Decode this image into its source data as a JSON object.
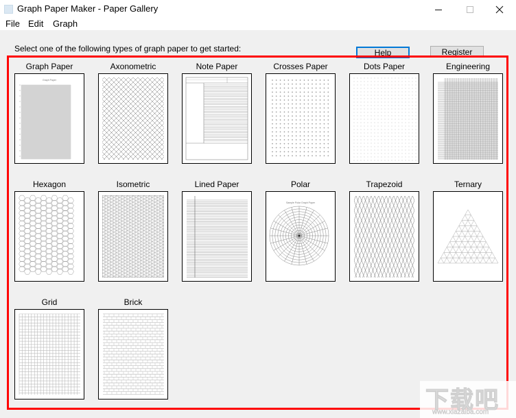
{
  "window": {
    "title": "Graph Paper Maker - Paper Gallery",
    "controls": {
      "minimize": "minimize",
      "maximize": "maximize",
      "close": "close"
    }
  },
  "menu": {
    "items": [
      {
        "label": "File"
      },
      {
        "label": "Edit"
      },
      {
        "label": "Graph"
      }
    ]
  },
  "main": {
    "instruction": "Select one of the following types of graph paper to get started:",
    "help_label": "Help",
    "register_label": "Register",
    "highlight_color": "#ff0000",
    "focus_color": "#0078d7",
    "papers": [
      {
        "label": "Graph Paper",
        "preview": "graph",
        "preview_title": "Graph Paper"
      },
      {
        "label": "Axonometric",
        "preview": "axonometric"
      },
      {
        "label": "Note Paper",
        "preview": "note"
      },
      {
        "label": "Crosses Paper",
        "preview": "crosses"
      },
      {
        "label": "Dots Paper",
        "preview": "dots"
      },
      {
        "label": "Engineering",
        "preview": "engineering"
      },
      {
        "label": "Hexagon",
        "preview": "hexagon"
      },
      {
        "label": "Isometric",
        "preview": "isometric"
      },
      {
        "label": "Lined Paper",
        "preview": "lined"
      },
      {
        "label": "Polar",
        "preview": "polar",
        "preview_title": "Sample Polar Graph Paper"
      },
      {
        "label": "Trapezoid",
        "preview": "trapezoid"
      },
      {
        "label": "Ternary",
        "preview": "ternary"
      },
      {
        "label": "Grid",
        "preview": "grid"
      },
      {
        "label": "Brick",
        "preview": "brick"
      }
    ]
  },
  "watermark": {
    "text": "下载吧",
    "url": "www.xiazaiba.com"
  }
}
